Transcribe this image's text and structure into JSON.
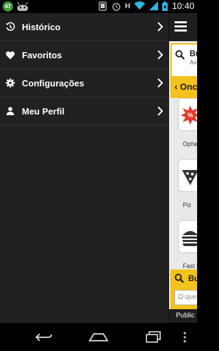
{
  "status_bar": {
    "notification_count": "47",
    "network_letter": "H",
    "time": "10:40"
  },
  "drawer": {
    "items": [
      {
        "label": "Histórico",
        "icon": "history-icon"
      },
      {
        "label": "Favoritos",
        "icon": "heart-icon"
      },
      {
        "label": "Configurações",
        "icon": "gear-icon"
      },
      {
        "label": "Meu Perfil",
        "icon": "person-icon"
      }
    ]
  },
  "content": {
    "search_card_title": "Bu",
    "search_card_sub": "Av",
    "strip_label": "Onc",
    "categories": [
      {
        "label": "Ophe",
        "icon": "badge-icon"
      },
      {
        "label": "Piz",
        "icon": "pizza-icon"
      },
      {
        "label": "Fast F",
        "icon": "burger-icon"
      }
    ],
    "search2_title": "Bu",
    "search2_placeholder": "O que",
    "publi_label": "Public"
  },
  "colors": {
    "accent": "#f3c21b",
    "drawer_bg": "#212121",
    "divider": "#333333"
  }
}
